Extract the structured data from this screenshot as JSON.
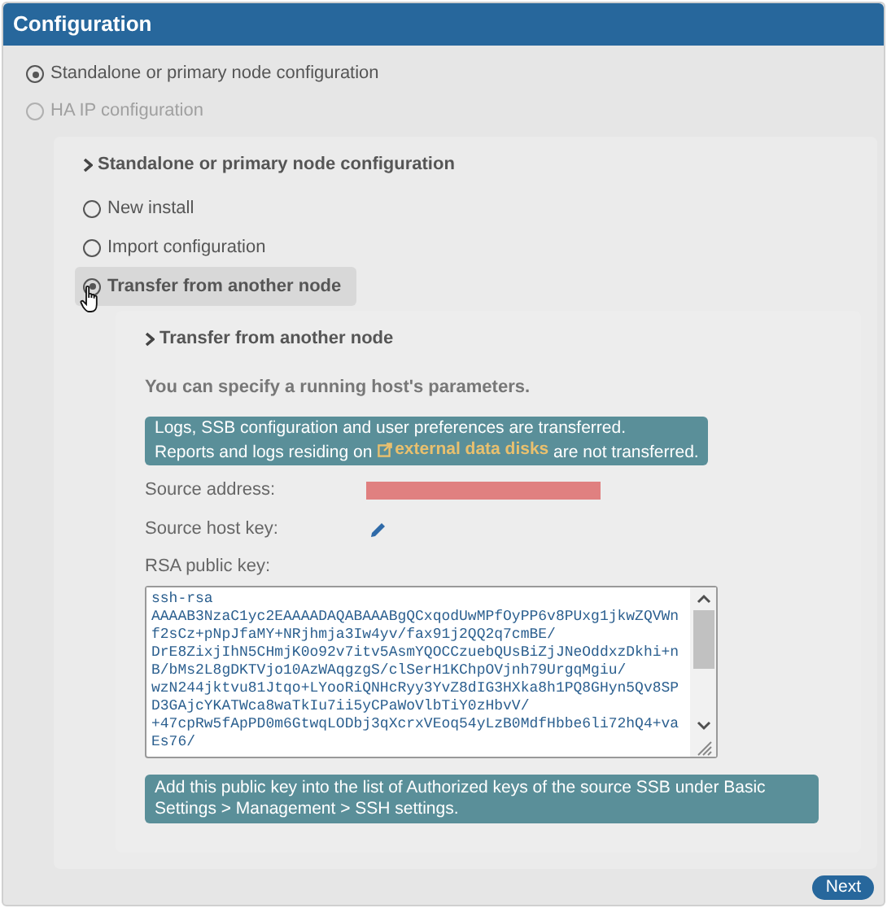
{
  "window": {
    "title": "Configuration"
  },
  "modes": [
    {
      "label": "Standalone or primary node configuration",
      "selected": true,
      "disabled": false
    },
    {
      "label": "HA IP configuration",
      "selected": false,
      "disabled": true
    }
  ],
  "standalone": {
    "heading": "Standalone or primary node configuration",
    "options": [
      {
        "label": "New install",
        "selected": false
      },
      {
        "label": "Import configuration",
        "selected": false
      },
      {
        "label": "Transfer from another node",
        "selected": true
      }
    ]
  },
  "transfer": {
    "heading": "Transfer from another node",
    "intro": "You can specify a running host's parameters.",
    "info_lines": [
      "Logs, SSB configuration and user preferences are transferred.",
      "Reports and logs residing on "
    ],
    "info_link": "external data disks",
    "info_tail": " are not transferred.",
    "source_address_label": "Source address:",
    "source_address": {
      "redacted": true
    },
    "source_host_key_label": "Source host key:",
    "rsa_label": "RSA public key:",
    "rsa_key": "ssh-rsa\nAAAAB3NzaC1yc2EAAAADAQABAAABgQCxqodUwMPfOyPP6v8PUxg1jkwZQVWn\nf2sCz+pNpJfaMY+NRjhmja3Iw4yv/fax91j2QQ2q7cmBE/\nDrE8ZixjIhN5CHmjK0o92v7itv5AsmYQOCCzuebQUsBiZjJNeOddxzDkhi+n\nB/bMs2L8gDKTVjo10AzWAqgzgS/clSerH1KChpOVjnh79UrgqMgiu/\nwzN244jktvu81Jtqo+LYooRiQNHcRyy3YvZ8dIG3HXka8h1PQ8GHyn5Qv8SP\nD3GAjcYKATWca8waTkIu7ii5yCPaWoVlbTiY0zHbvV/\n+47cpRw5fApPD0m6GtwqLODbj3qXcrxVEoq54yLzB0MdfHbbe6li72hQ4+va\nEs76/",
    "note": "Add this public key into the list of Authorized keys of the source SSB under Basic Settings > Management > SSH settings."
  },
  "next_button": "Next"
}
